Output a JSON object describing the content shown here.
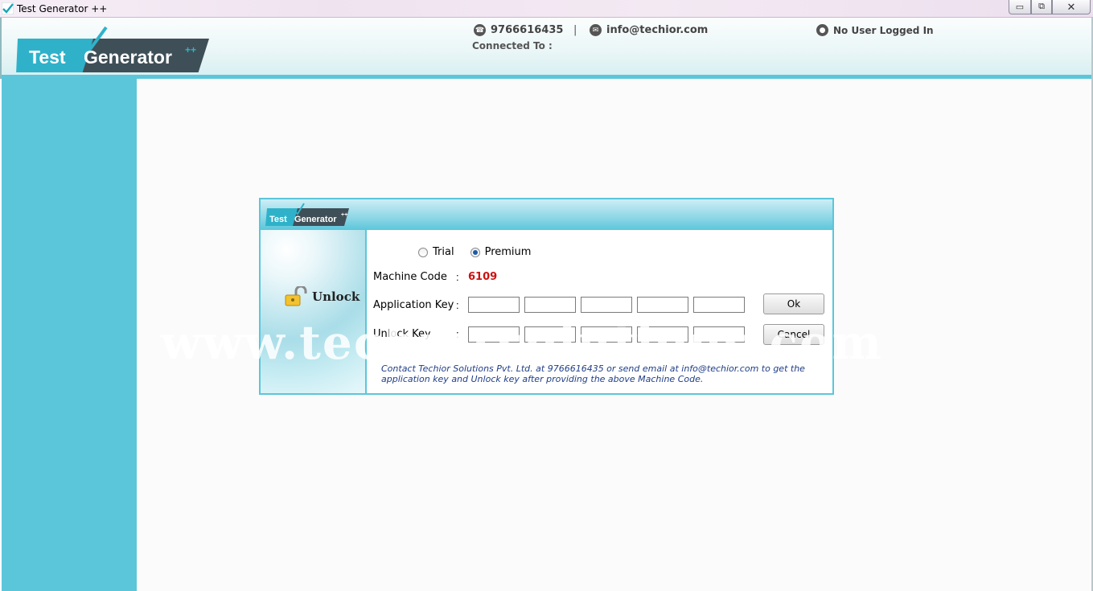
{
  "window": {
    "title": "Test Generator ++",
    "buttons": {
      "minimize": "▭",
      "maximize": "⧉",
      "close": "✕"
    }
  },
  "header": {
    "logo": {
      "word1": "Test",
      "word2": "Generator",
      "sup": "++"
    },
    "phone": "9766616435",
    "separator": "|",
    "email": "info@techior.com",
    "connected_label": "Connected To :",
    "user_status": "No User Logged In"
  },
  "dialog": {
    "logo": {
      "word1": "Test",
      "word2": "Generator",
      "sup": "++"
    },
    "unlock_label": "Unlock",
    "radio": {
      "trial": "Trial",
      "premium": "Premium",
      "selected": "Premium"
    },
    "machine_code_label": "Machine Code",
    "machine_code_value": "6109",
    "application_key_label": "Application Key",
    "unlock_key_label": "Unlock Key",
    "colon": ":",
    "ok_button": "Ok",
    "cancel_button": "Cancel",
    "info_text": "Contact Techior Solutions Pvt. Ltd. at 9766616435 or send email at info@techior.com to get the application key and Unlock key after providing the above Machine Code."
  },
  "watermark": "www.techiorsolutions.com",
  "colors": {
    "accent": "#5bc6da",
    "machine_code": "#cc1111",
    "info_text": "#1f3d86"
  }
}
